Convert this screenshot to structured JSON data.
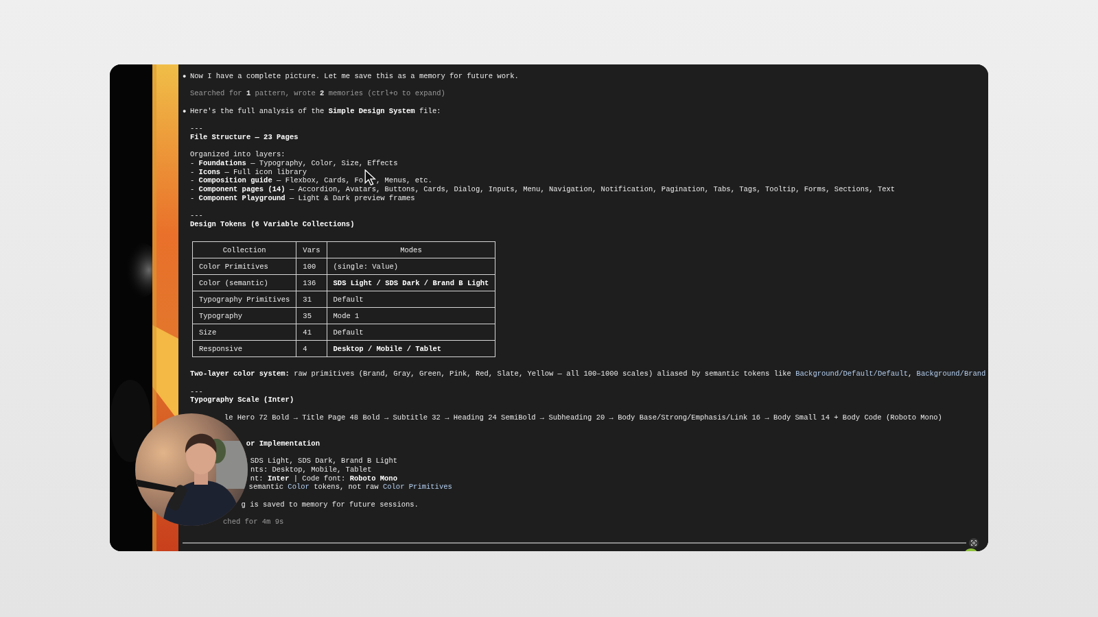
{
  "terminal": {
    "lines": [
      {
        "kind": "bullet",
        "marker": "●",
        "parts": [
          {
            "kind": "text",
            "text": "Now I have a complete picture. Let me save this as a memory for future work."
          }
        ]
      },
      {
        "kind": "blank"
      },
      {
        "kind": "note",
        "parts": [
          {
            "kind": "text",
            "text": "Searched for **1** pattern, wrote **2** memories (ctrl+o to expand)"
          }
        ]
      },
      {
        "kind": "blank"
      },
      {
        "kind": "bullet",
        "marker": "●",
        "parts": [
          {
            "kind": "text",
            "text": "Here's the full analysis of the **Simple Design System** file:"
          }
        ]
      },
      {
        "kind": "blank"
      },
      {
        "kind": "rule",
        "parts": [
          {
            "kind": "text",
            "text": "---"
          }
        ]
      },
      {
        "kind": "heading",
        "parts": [
          {
            "kind": "text",
            "text": "File Structure — 23 Pages"
          }
        ]
      },
      {
        "kind": "blank"
      },
      {
        "kind": "text",
        "parts": [
          {
            "kind": "text",
            "text": "Organized into layers:"
          }
        ]
      },
      {
        "kind": "text",
        "parts": [
          {
            "kind": "text",
            "text": "- **Foundations** — Typography, Color, Size, Effects"
          }
        ]
      },
      {
        "kind": "text",
        "parts": [
          {
            "kind": "text",
            "text": "- **Icons** — Full icon library"
          }
        ]
      },
      {
        "kind": "text",
        "parts": [
          {
            "kind": "text",
            "text": "- **Composition guide** — Flexbox, Cards, Fo"
          },
          {
            "kind": "cursor"
          },
          {
            "kind": "text",
            "text": ", Menus, etc."
          }
        ]
      },
      {
        "kind": "text",
        "parts": [
          {
            "kind": "text",
            "text": "- **Component pages (14)** — Accordion, Avatars, Buttons, Cards, Dialog, Inputs, Menu, Navigation, Notification, Pagination, Tabs, Tags, Tooltip, Forms, Sections, Text"
          }
        ]
      },
      {
        "kind": "text",
        "parts": [
          {
            "kind": "text",
            "text": "- **Component Playground** — Light & Dark preview frames"
          }
        ]
      },
      {
        "kind": "blank"
      },
      {
        "kind": "rule",
        "parts": [
          {
            "kind": "text",
            "text": "---"
          }
        ]
      },
      {
        "kind": "heading",
        "parts": [
          {
            "kind": "text",
            "text": "Design Tokens (6 Variable Collections)"
          }
        ]
      },
      {
        "kind": "table",
        "columns": [
          "Collection",
          "Vars",
          "Modes"
        ],
        "rows": [
          {
            "collection": "Color Primitives",
            "vars": "100",
            "modes": "(single: Value)",
            "modes_bold": false
          },
          {
            "collection": "Color (semantic)",
            "vars": "136",
            "modes": "SDS Light / SDS Dark / Brand B Light",
            "modes_bold": true
          },
          {
            "collection": "Typography Primitives",
            "vars": "31",
            "modes": "Default",
            "modes_bold": false
          },
          {
            "collection": "Typography",
            "vars": "35",
            "modes": "Mode 1",
            "modes_bold": false
          },
          {
            "collection": "Size",
            "vars": "41",
            "modes": "Default",
            "modes_bold": false
          },
          {
            "collection": "Responsive",
            "vars": "4",
            "modes": "Desktop / Mobile / Tablet",
            "modes_bold": true
          }
        ]
      },
      {
        "kind": "text",
        "parts": [
          {
            "kind": "text",
            "text": "**Two-layer color system:** raw primitives (Brand, Gray, Green, Pink, Red, Slate, Yellow — all 100–1000 scales) aliased by semantic tokens like "
          },
          {
            "kind": "link",
            "text": "Background/Default/Default"
          },
          {
            "kind": "text",
            "text": ", "
          },
          {
            "kind": "link",
            "text": "Background/Brand"
          }
        ]
      },
      {
        "kind": "blank"
      },
      {
        "kind": "rule",
        "parts": [
          {
            "kind": "text",
            "text": "---"
          }
        ]
      },
      {
        "kind": "heading",
        "parts": [
          {
            "kind": "text",
            "text": "Typography Scale (Inter)"
          }
        ]
      },
      {
        "kind": "webcam"
      },
      {
        "kind": "blank"
      },
      {
        "kind": "text",
        "parts": [
          {
            "kind": "text",
            "text": "le Hero 72 Bold → Title Page 48 Bold → Subtitle 32 → Heading 24 SemiBold → Subheading 20 → Body Base/Strong/Emphasis/Link 16 → Body Small 14 + Body Code (Roboto Mono)"
          }
        ]
      },
      {
        "kind": "blank"
      },
      {
        "kind": "blank"
      },
      {
        "kind": "heading",
        "parts": [
          {
            "kind": "text",
            "text": "or Implementation"
          }
        ]
      },
      {
        "kind": "blank"
      },
      {
        "kind": "text",
        "parts": [
          {
            "kind": "text",
            "text": "SDS Light, SDS Dark, Brand B Light"
          }
        ]
      },
      {
        "kind": "text",
        "parts": [
          {
            "kind": "text",
            "text": "nts: Desktop, Mobile, Tablet"
          }
        ]
      },
      {
        "kind": "text",
        "parts": [
          {
            "kind": "text",
            "text": "nt: **Inter** | Code font: **Roboto Mono**"
          }
        ]
      },
      {
        "kind": "text",
        "parts": [
          {
            "kind": "text",
            "text": "semantic "
          },
          {
            "kind": "link",
            "text": "Color"
          },
          {
            "kind": "text",
            "text": " tokens, not raw "
          },
          {
            "kind": "link",
            "text": "Color Primitives"
          }
        ]
      },
      {
        "kind": "blank"
      },
      {
        "kind": "text",
        "parts": [
          {
            "kind": "text",
            "text": "g is saved to memory for future sessions."
          }
        ]
      },
      {
        "kind": "blank"
      },
      {
        "kind": "note",
        "parts": [
          {
            "kind": "text",
            "text": "ched for 4m 9s"
          }
        ]
      }
    ]
  }
}
